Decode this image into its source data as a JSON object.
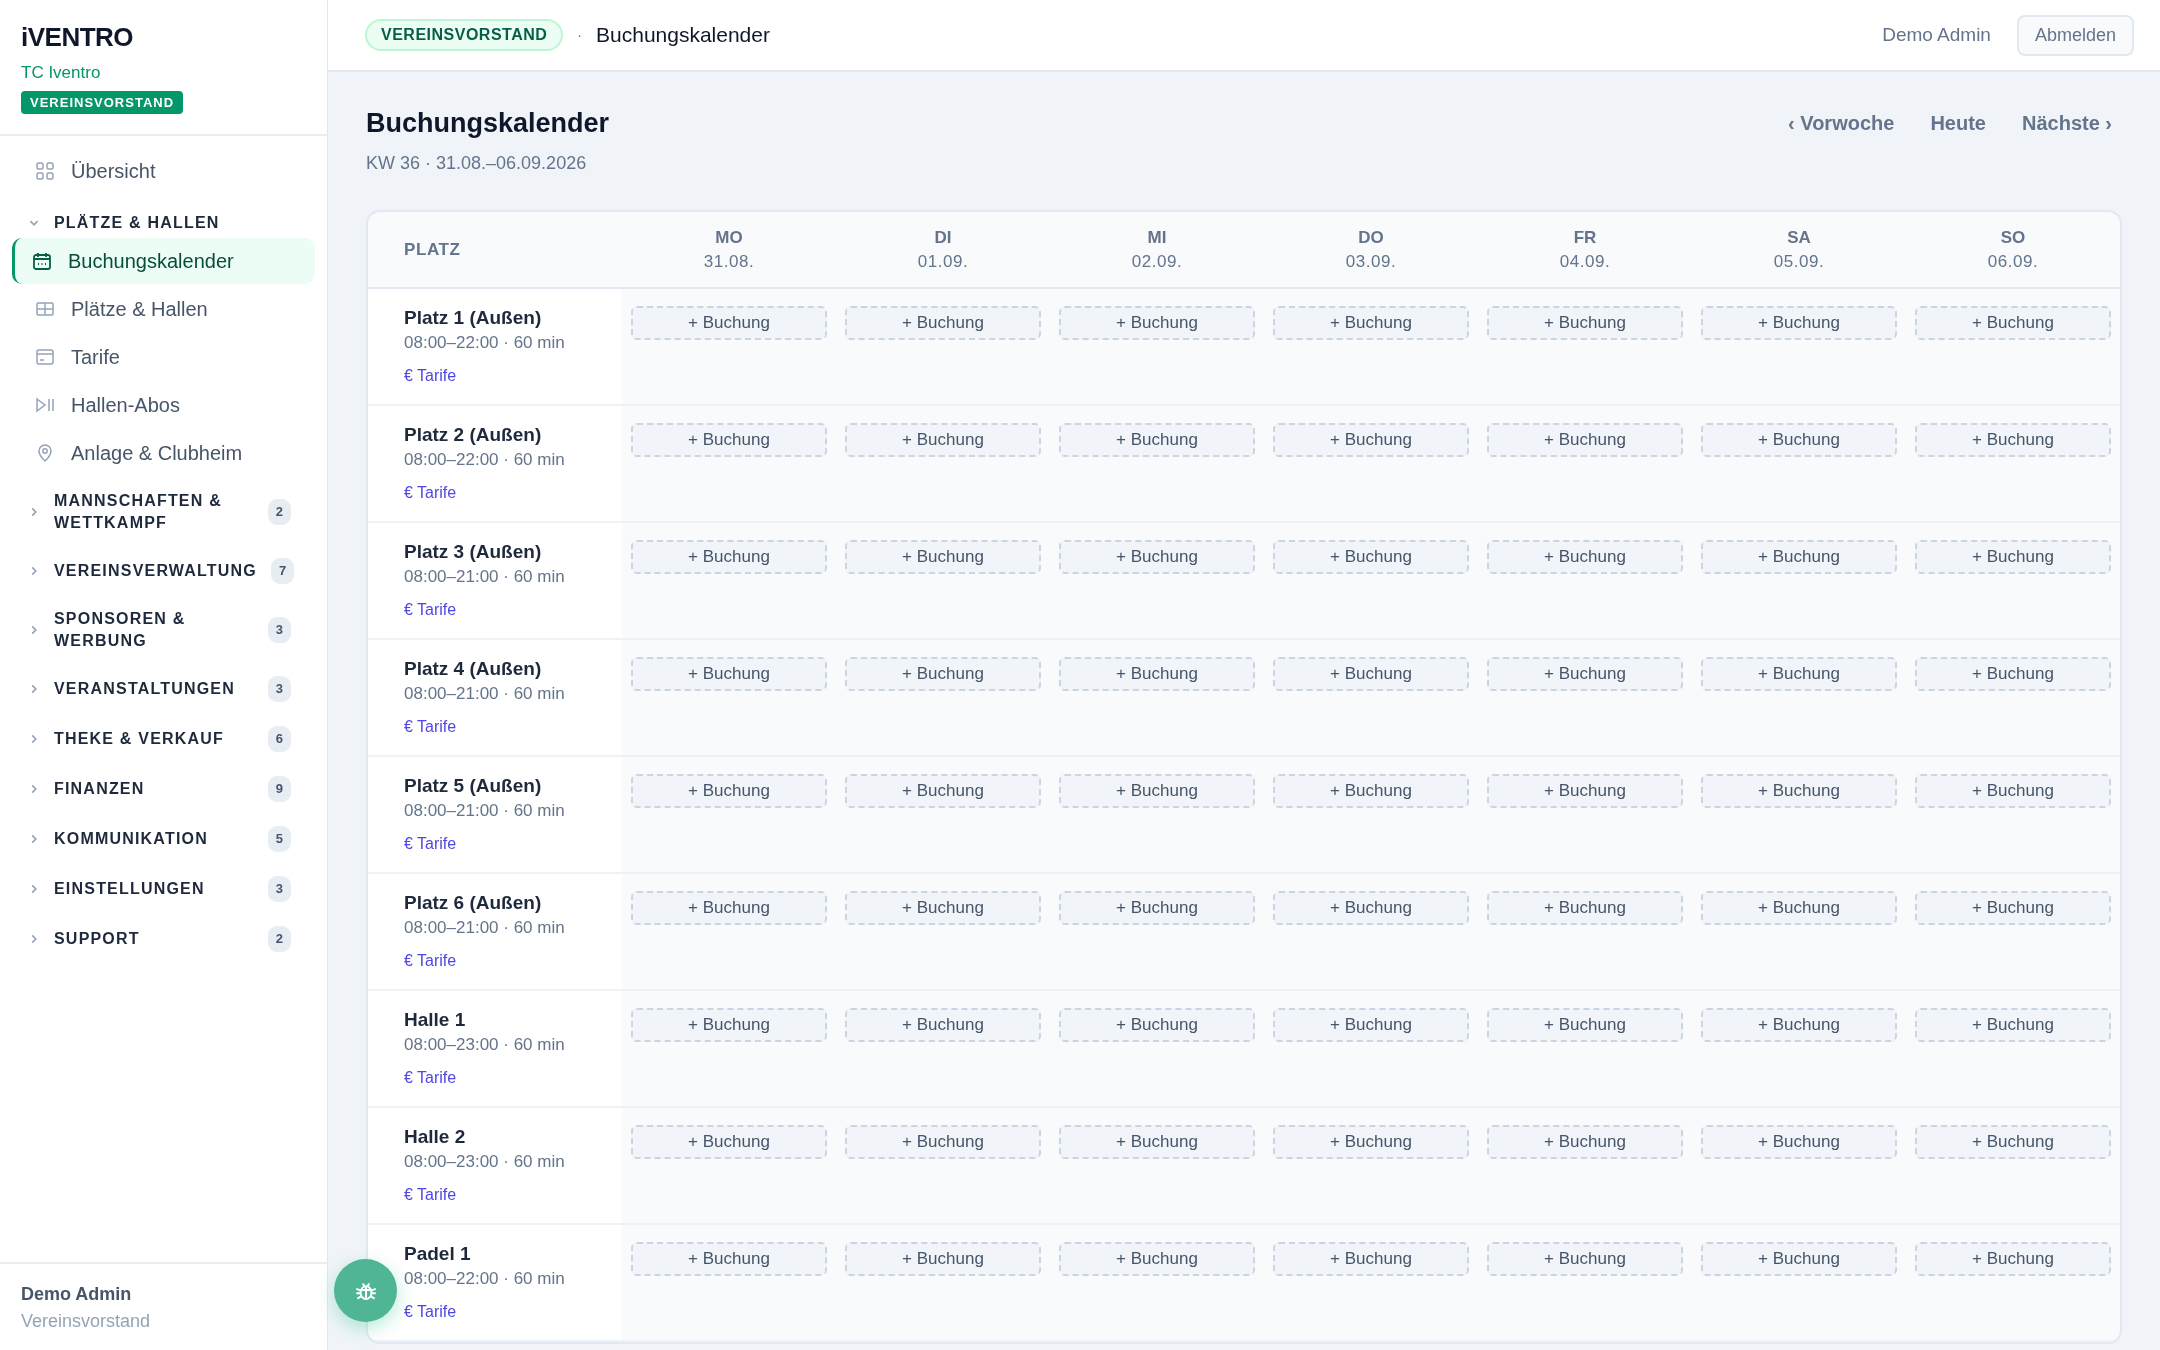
{
  "sidebar": {
    "brand": "iVENTRO",
    "club": "TC Iventro",
    "role_badge": "VEREINSVORSTAND",
    "nav": [
      {
        "kind": "link",
        "label": "Übersicht",
        "selected": false
      },
      {
        "kind": "group",
        "label": "PLÄTZE & HALLEN",
        "expanded": true,
        "children": [
          {
            "kind": "link",
            "label": "Buchungskalender",
            "selected": true
          },
          {
            "kind": "link",
            "label": "Plätze & Hallen",
            "selected": false
          },
          {
            "kind": "link",
            "label": "Tarife",
            "selected": false
          },
          {
            "kind": "link",
            "label": "Hallen-Abos",
            "selected": false
          },
          {
            "kind": "link",
            "label": "Anlage & Clubheim",
            "selected": false
          }
        ]
      },
      {
        "kind": "group",
        "label": "MANNSCHAFTEN & WETTKAMPF",
        "expanded": false,
        "count": "2"
      },
      {
        "kind": "group",
        "label": "VEREINSVERWALTUNG",
        "expanded": false,
        "count": "7"
      },
      {
        "kind": "group",
        "label": "SPONSOREN & WERBUNG",
        "expanded": false,
        "count": "3"
      },
      {
        "kind": "group",
        "label": "VERANSTALTUNGEN",
        "expanded": false,
        "count": "3"
      },
      {
        "kind": "group",
        "label": "THEKE & VERKAUF",
        "expanded": false,
        "count": "6"
      },
      {
        "kind": "group",
        "label": "FINANZEN",
        "expanded": false,
        "count": "9"
      },
      {
        "kind": "group",
        "label": "KOMMUNIKATION",
        "expanded": false,
        "count": "5"
      },
      {
        "kind": "group",
        "label": "EINSTELLUNGEN",
        "expanded": false,
        "count": "3"
      },
      {
        "kind": "group",
        "label": "SUPPORT",
        "expanded": false,
        "count": "2"
      }
    ],
    "user": {
      "name": "Demo Admin",
      "role": "Vereinsvorstand"
    }
  },
  "topbar": {
    "role_pill": "VEREINSVORSTAND",
    "separator": "·",
    "page": "Buchungskalender",
    "user": "Demo Admin",
    "logout": "Abmelden"
  },
  "page": {
    "title": "Buchungskalender",
    "subtitle": "KW 36 · 31.08.–06.09.2026",
    "nav": [
      "‹ Vorwoche",
      "Heute",
      "Nächste ›"
    ]
  },
  "calendar": {
    "first_column": "PLATZ",
    "days": [
      {
        "day": "MO",
        "date": "31.08."
      },
      {
        "day": "DI",
        "date": "01.09."
      },
      {
        "day": "MI",
        "date": "02.09."
      },
      {
        "day": "DO",
        "date": "03.09."
      },
      {
        "day": "FR",
        "date": "04.09."
      },
      {
        "day": "SA",
        "date": "05.09."
      },
      {
        "day": "SO",
        "date": "06.09."
      }
    ],
    "rows": [
      {
        "name": "Platz 1 (Außen)",
        "hours": "08:00–22:00 · 60 min",
        "tariff": "€ Tarife",
        "slots": [
          "+ Buchung",
          "+ Buchung",
          "+ Buchung",
          "+ Buchung",
          "+ Buchung",
          "+ Buchung",
          "+ Buchung"
        ]
      },
      {
        "name": "Platz 2 (Außen)",
        "hours": "08:00–22:00 · 60 min",
        "tariff": "€ Tarife",
        "slots": [
          "+ Buchung",
          "+ Buchung",
          "+ Buchung",
          "+ Buchung",
          "+ Buchung",
          "+ Buchung",
          "+ Buchung"
        ]
      },
      {
        "name": "Platz 3 (Außen)",
        "hours": "08:00–21:00 · 60 min",
        "tariff": "€ Tarife",
        "slots": [
          "+ Buchung",
          "+ Buchung",
          "+ Buchung",
          "+ Buchung",
          "+ Buchung",
          "+ Buchung",
          "+ Buchung"
        ]
      },
      {
        "name": "Platz 4 (Außen)",
        "hours": "08:00–21:00 · 60 min",
        "tariff": "€ Tarife",
        "slots": [
          "+ Buchung",
          "+ Buchung",
          "+ Buchung",
          "+ Buchung",
          "+ Buchung",
          "+ Buchung",
          "+ Buchung"
        ]
      },
      {
        "name": "Platz 5 (Außen)",
        "hours": "08:00–21:00 · 60 min",
        "tariff": "€ Tarife",
        "slots": [
          "+ Buchung",
          "+ Buchung",
          "+ Buchung",
          "+ Buchung",
          "+ Buchung",
          "+ Buchung",
          "+ Buchung"
        ]
      },
      {
        "name": "Platz 6 (Außen)",
        "hours": "08:00–21:00 · 60 min",
        "tariff": "€ Tarife",
        "slots": [
          "+ Buchung",
          "+ Buchung",
          "+ Buchung",
          "+ Buchung",
          "+ Buchung",
          "+ Buchung",
          "+ Buchung"
        ]
      },
      {
        "name": "Halle 1",
        "hours": "08:00–23:00 · 60 min",
        "tariff": "€ Tarife",
        "slots": [
          "+ Buchung",
          "+ Buchung",
          "+ Buchung",
          "+ Buchung",
          "+ Buchung",
          "+ Buchung",
          "+ Buchung"
        ]
      },
      {
        "name": "Halle 2",
        "hours": "08:00–23:00 · 60 min",
        "tariff": "€ Tarife",
        "slots": [
          "+ Buchung",
          "+ Buchung",
          "+ Buchung",
          "+ Buchung",
          "+ Buchung",
          "+ Buchung",
          "+ Buchung"
        ]
      },
      {
        "name": "Padel 1",
        "hours": "08:00–22:00 · 60 min",
        "tariff": "€ Tarife",
        "slots": [
          "+ Buchung",
          "+ Buchung",
          "+ Buchung",
          "+ Buchung",
          "+ Buchung",
          "+ Buchung",
          "+ Buchung"
        ]
      }
    ]
  }
}
